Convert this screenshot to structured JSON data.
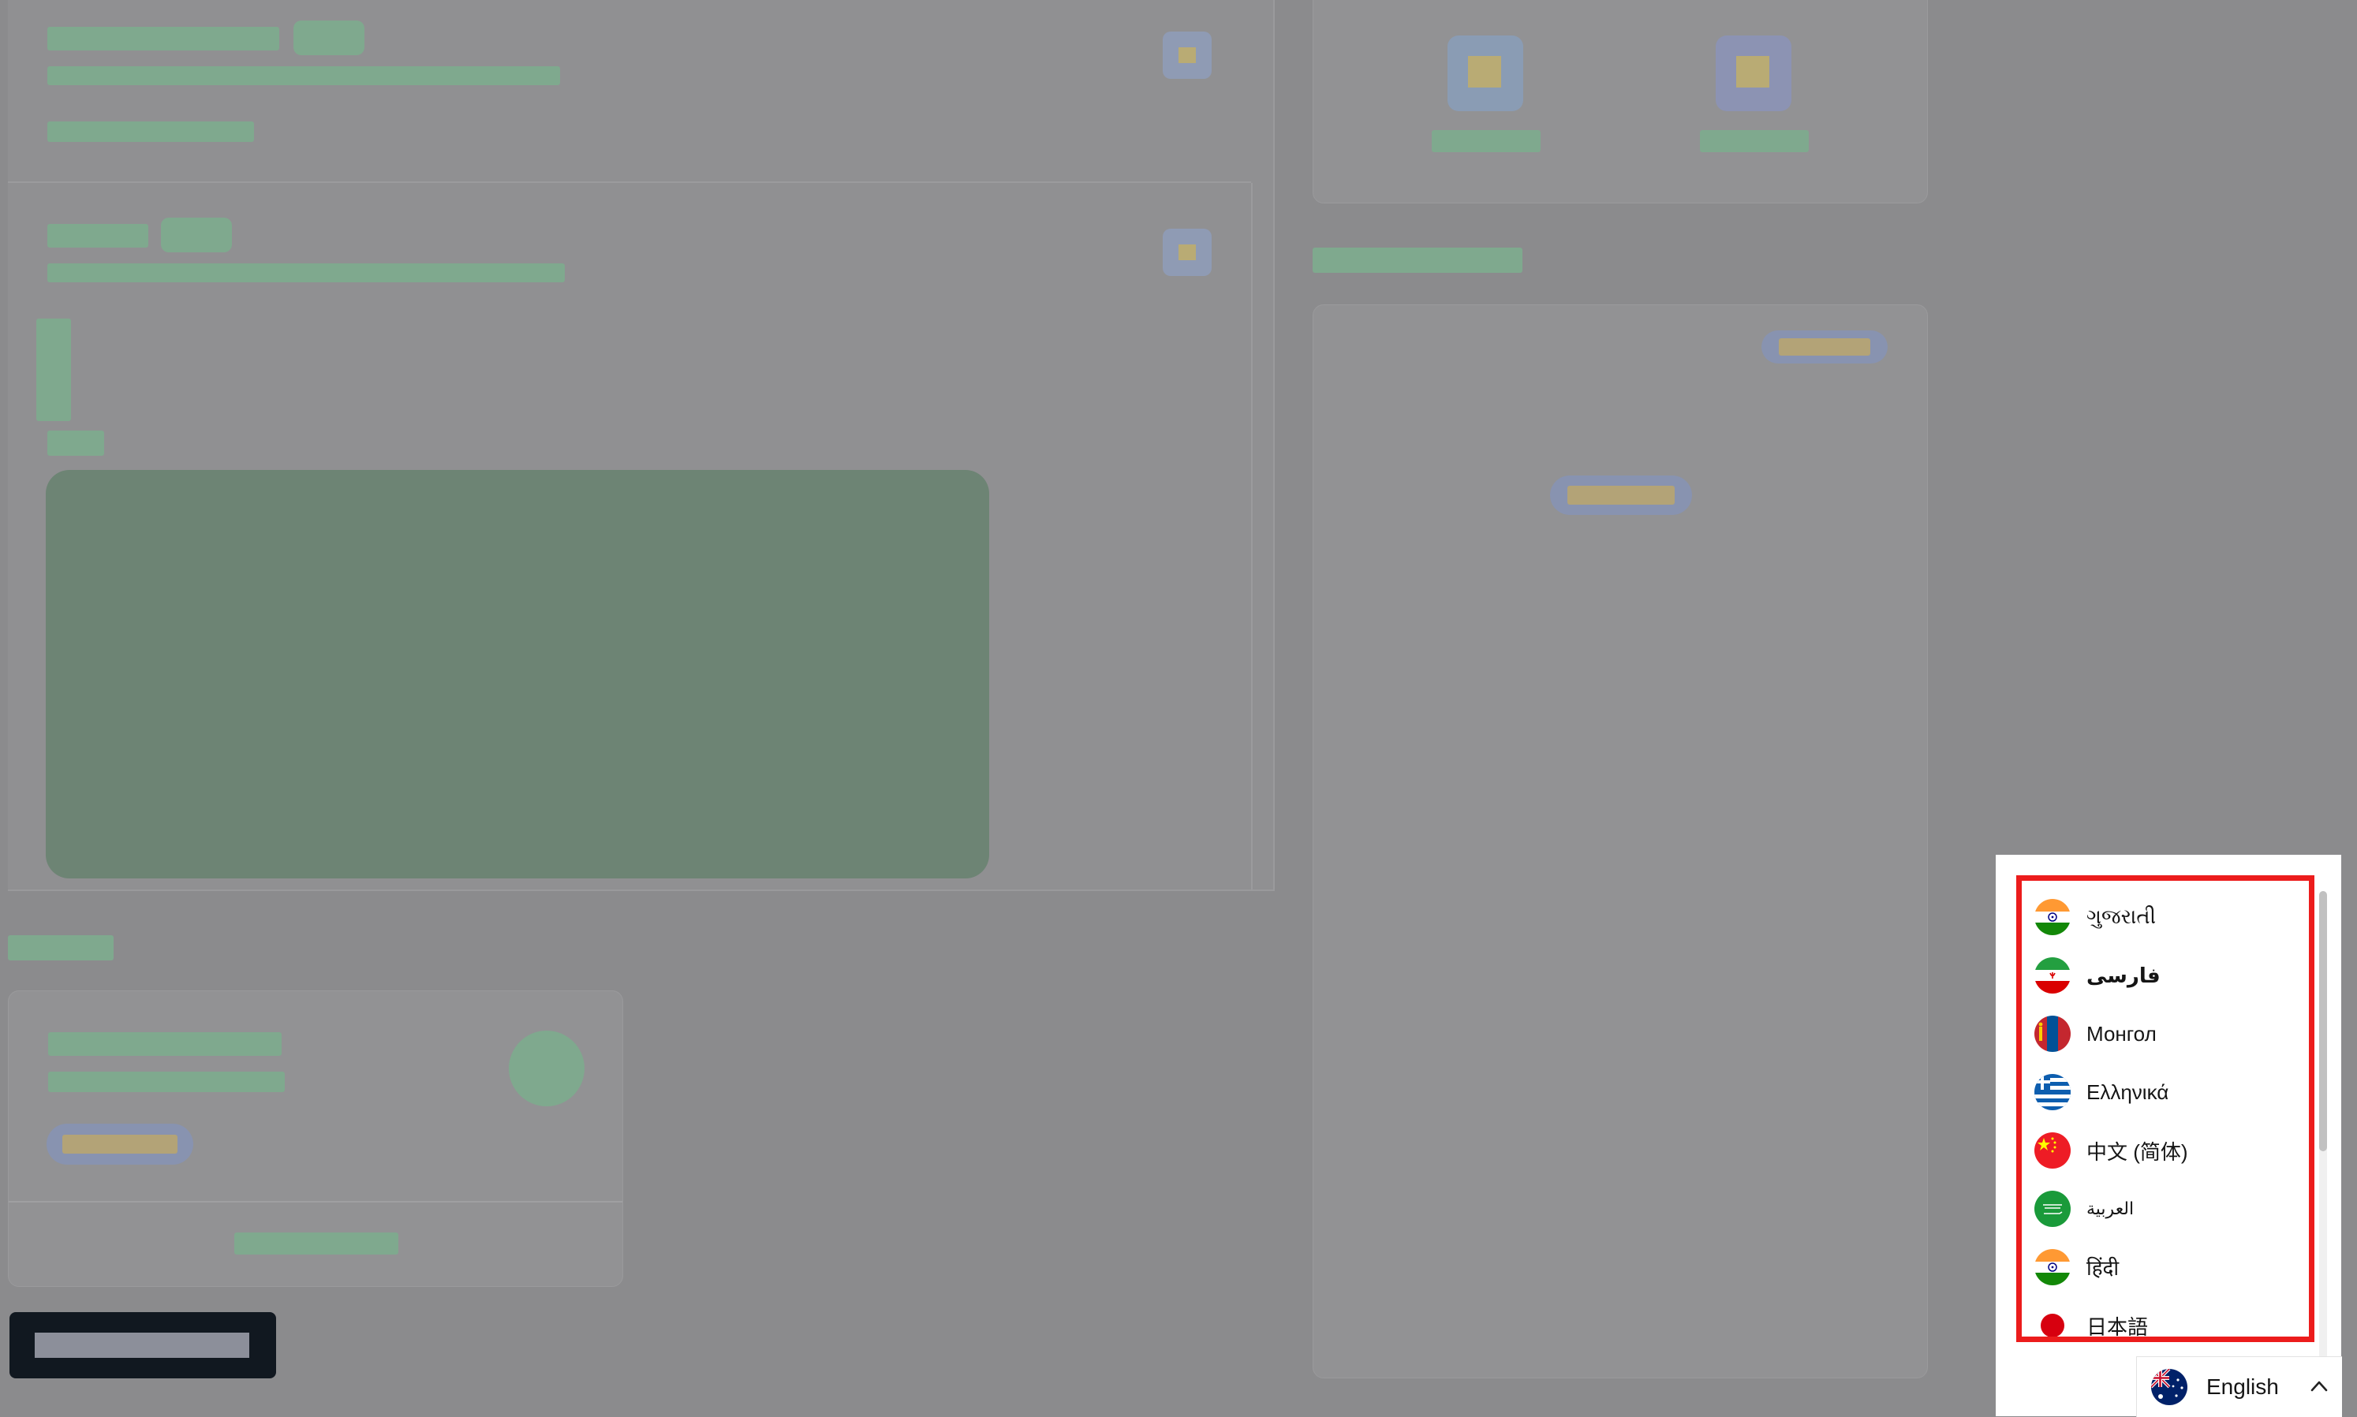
{
  "language_menu": {
    "items": [
      {
        "label": "ગુજરાતી",
        "flag": "india-flag-icon",
        "bold": false
      },
      {
        "label": "فارسی",
        "flag": "iran-flag-icon",
        "bold": true
      },
      {
        "label": "Монгол",
        "flag": "mongolia-flag-icon",
        "bold": false
      },
      {
        "label": "Ελληνικά",
        "flag": "greece-flag-icon",
        "bold": false
      },
      {
        "label": "中文 (简体)",
        "flag": "china-flag-icon",
        "bold": false
      },
      {
        "label": "العربية",
        "flag": "saudi-arabia-flag-icon",
        "bold": false
      },
      {
        "label": "हिंदी",
        "flag": "india-flag-icon",
        "bold": false
      },
      {
        "label": "日本語",
        "flag": "japan-flag-icon",
        "bold": false
      }
    ],
    "selected": {
      "label": "English",
      "flag": "australia-flag-icon"
    },
    "highlight_color": "#ec1c1c"
  },
  "colors": {
    "overlay": "#8b8b8d",
    "skeleton_green": "#7fa98e",
    "dark_button": "#111820"
  }
}
